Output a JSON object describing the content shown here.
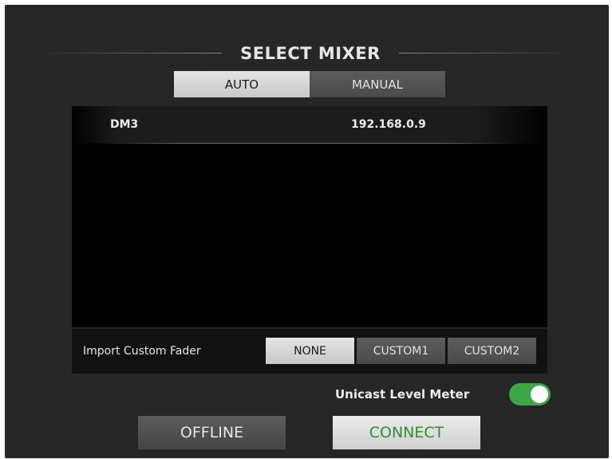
{
  "dialog": {
    "title": "SELECT MIXER"
  },
  "mode_tabs": [
    {
      "label": "AUTO",
      "selected": true
    },
    {
      "label": "MANUAL",
      "selected": false
    }
  ],
  "mixers": [
    {
      "name": "DM3",
      "ip": "192.168.0.9"
    }
  ],
  "import_custom_fader": {
    "label": "Import Custom Fader",
    "options": [
      {
        "label": "NONE",
        "selected": true
      },
      {
        "label": "CUSTOM1",
        "selected": false
      },
      {
        "label": "CUSTOM2",
        "selected": false
      }
    ]
  },
  "unicast_level_meter": {
    "label": "Unicast Level Meter",
    "enabled": true
  },
  "buttons": {
    "offline_label": "OFFLINE",
    "connect_label": "CONNECT"
  },
  "colors": {
    "background": "#262626",
    "list_background": "#000000",
    "toggle_on": "#3fa646",
    "connect_text": "#2f8f2f"
  }
}
